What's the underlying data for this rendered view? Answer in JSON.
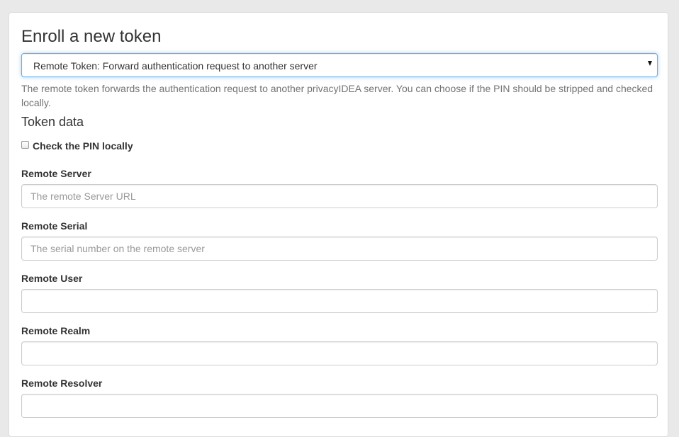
{
  "enroll": {
    "title": "Enroll a new token",
    "token_type_selected": "Remote Token: Forward authentication request to another server",
    "description": "The remote token forwards the authentication request to another privacyIDEA server. You can choose if the PIN should be stripped and checked locally."
  },
  "token_data": {
    "title": "Token data",
    "check_pin_label": "Check the PIN locally",
    "check_pin_checked": false,
    "fields": {
      "remote_server": {
        "label": "Remote Server",
        "placeholder": "The remote Server URL",
        "value": ""
      },
      "remote_serial": {
        "label": "Remote Serial",
        "placeholder": "The serial number on the remote server",
        "value": ""
      },
      "remote_user": {
        "label": "Remote User",
        "placeholder": "",
        "value": ""
      },
      "remote_realm": {
        "label": "Remote Realm",
        "placeholder": "",
        "value": ""
      },
      "remote_resolver": {
        "label": "Remote Resolver",
        "placeholder": "",
        "value": ""
      }
    }
  },
  "colors": {
    "background": "#e9e9e9",
    "panel": "#ffffff",
    "focus_border": "#66afe9",
    "input_border": "#cccccc",
    "help_text": "#737373",
    "text": "#333333"
  },
  "icons": {
    "select_arrow": "caret-down-icon"
  }
}
